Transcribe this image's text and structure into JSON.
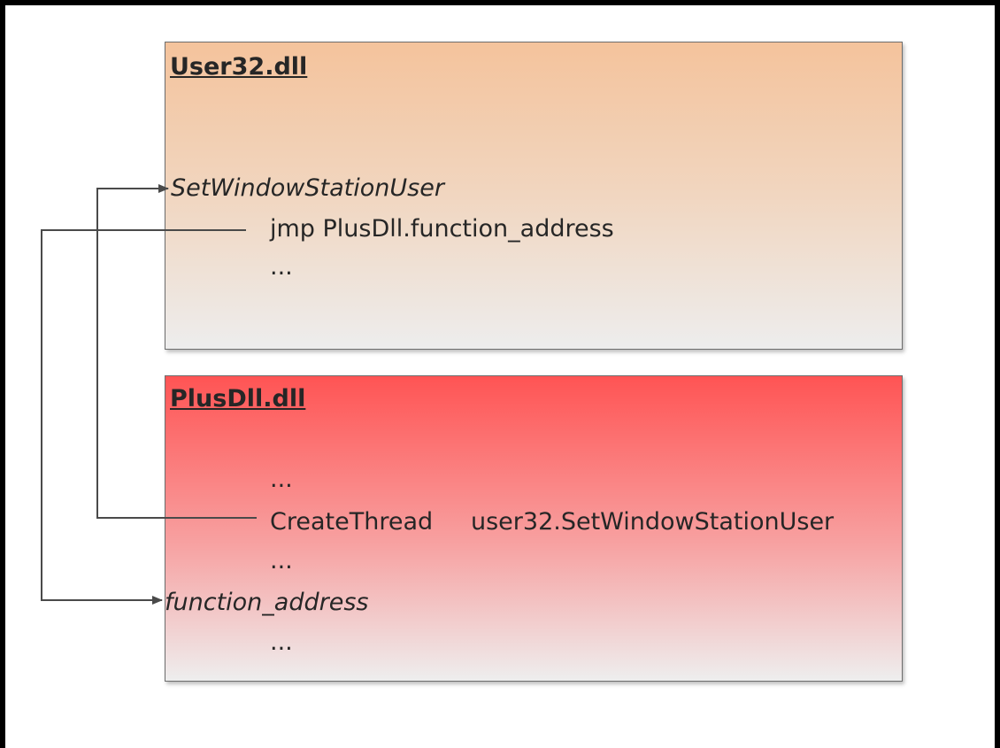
{
  "user32": {
    "title": "User32.dll",
    "function_label": "SetWindowStationUser",
    "jmp_line": "jmp PlusDll.function_address",
    "ellipsis": "..."
  },
  "plusdll": {
    "title": "PlusDll.dll",
    "ellipsis_top": "...",
    "create_thread": "CreateThread",
    "create_thread_arg": "user32.SetWindowStationUser",
    "ellipsis_mid": "...",
    "function_label": "function_address",
    "ellipsis_bottom": "..."
  }
}
